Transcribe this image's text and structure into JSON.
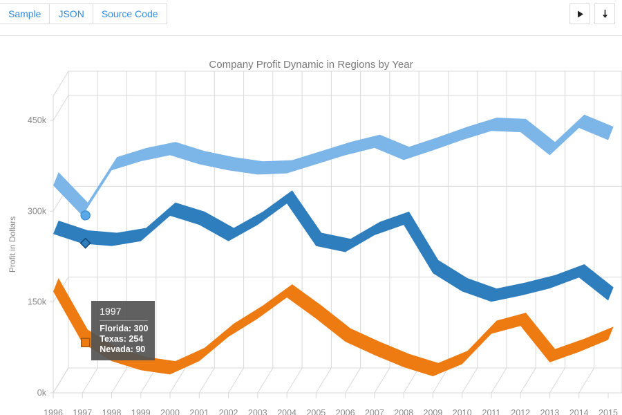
{
  "toolbar": {
    "tabs": [
      {
        "label": "Sample",
        "name": "tab-sample"
      },
      {
        "label": "JSON",
        "name": "tab-json"
      },
      {
        "label": "Source Code",
        "name": "tab-source-code"
      }
    ],
    "actions": [
      {
        "label": "▶",
        "name": "play-icon"
      },
      {
        "label": "↓",
        "name": "download-icon"
      }
    ]
  },
  "tooltip": {
    "title": "1997",
    "rows": [
      "Florida: 300",
      "Texas: 254",
      "Nevada: 90"
    ]
  },
  "colors": {
    "florida": "#7cb5e8",
    "texas": "#2e7ebe",
    "nevada": "#ee7b11",
    "axis_text": "#8a8a8a",
    "grid": "#d8d8d8",
    "title_text": "#7a7a7a",
    "tab_text": "#2f8ae0",
    "tooltip_bg": "#525252"
  },
  "chart_data": {
    "type": "line",
    "title": "Company Profit Dynamic in Regions by Year",
    "xlabel": "",
    "ylabel": "Profit in Dollars",
    "ylim": [
      0,
      490
    ],
    "yticks": [
      0,
      150,
      300,
      450
    ],
    "ytick_labels": [
      "0k",
      "150k",
      "300k",
      "450k"
    ],
    "grid": true,
    "legend_position": "top",
    "threed": true,
    "x": [
      1996,
      1997,
      1998,
      1999,
      2000,
      2001,
      2002,
      2003,
      2004,
      2005,
      2006,
      2007,
      2008,
      2009,
      2010,
      2011,
      2012,
      2013,
      2014,
      2015
    ],
    "categories": [
      "1996",
      "1997",
      "1998",
      "1999",
      "2000",
      "2001",
      "2002",
      "2003",
      "2004",
      "2005",
      "2006",
      "2007",
      "2008",
      "2009",
      "2010",
      "2011",
      "2012",
      "2013",
      "2014",
      "2015"
    ],
    "series": [
      {
        "name": "Florida",
        "color": "#7cb5e8",
        "marker": "circle",
        "values": [
          350,
          300,
          375,
          390,
          400,
          385,
          375,
          368,
          370,
          385,
          400,
          412,
          392,
          408,
          425,
          440,
          438,
          400,
          445,
          425
        ]
      },
      {
        "name": "Texas",
        "color": "#2e7ebe",
        "marker": "diamond",
        "values": [
          270,
          254,
          250,
          258,
          300,
          285,
          258,
          285,
          320,
          250,
          240,
          268,
          285,
          205,
          175,
          158,
          168,
          180,
          198,
          160
        ]
      },
      {
        "name": "Nevada",
        "color": "#ee7b11",
        "marker": "square",
        "values": [
          175,
          90,
          60,
          45,
          38,
          60,
          100,
          130,
          165,
          130,
          92,
          70,
          50,
          35,
          55,
          105,
          118,
          58,
          75,
          95
        ]
      }
    ],
    "highlighted_point": {
      "category": "1997",
      "index": 1
    }
  }
}
